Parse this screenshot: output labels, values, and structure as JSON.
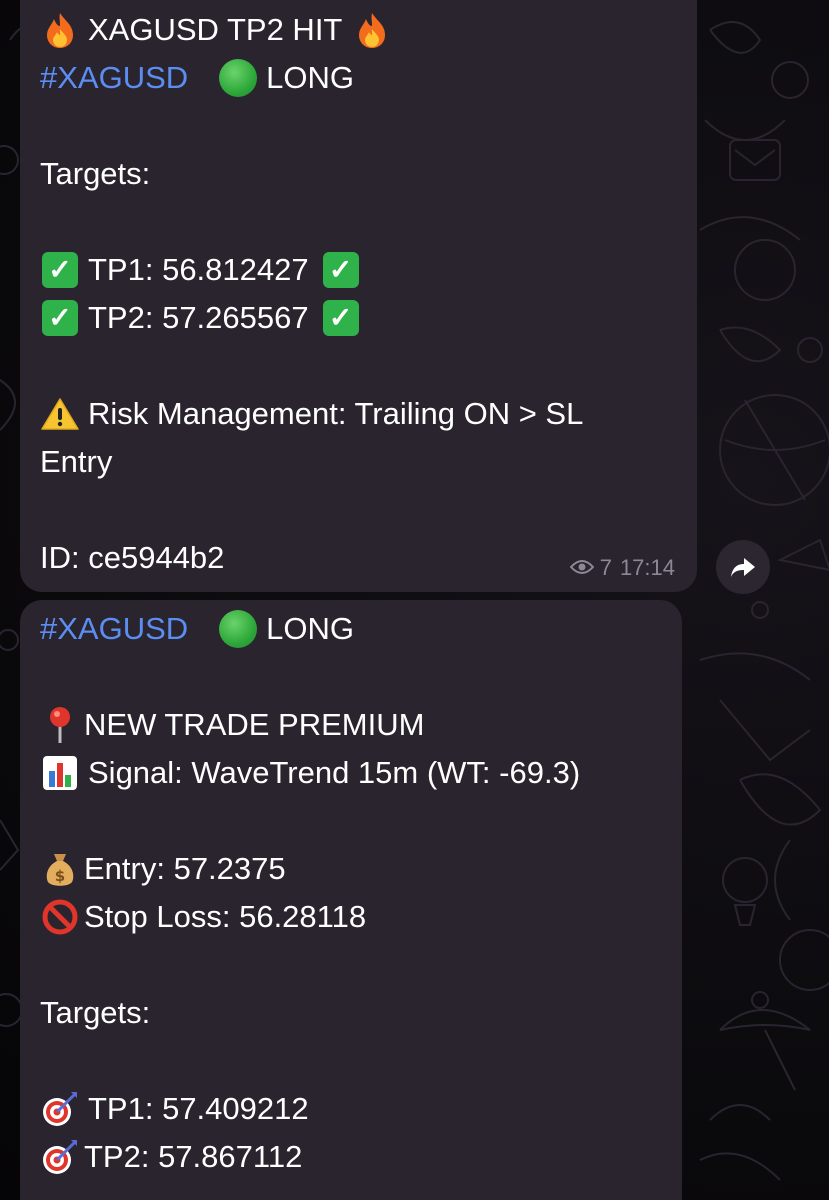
{
  "message1": {
    "title": "XAGUSD TP2 HIT",
    "hashtag": "#XAGUSD",
    "direction": "LONG",
    "targets_label": "Targets:",
    "tp1": "TP1: 56.812427",
    "tp2": "TP2: 57.265567",
    "risk_line1": "Risk Management: Trailing ON > SL",
    "risk_line2": "Entry",
    "id": "ID: ce5944b2",
    "views": "7",
    "time": "17:14"
  },
  "message2": {
    "hashtag": "#XAGUSD",
    "direction": "LONG",
    "new_trade": "NEW TRADE PREMIUM",
    "signal": "Signal: WaveTrend 15m (WT: -69.3)",
    "entry": "Entry: 57.2375",
    "stop_loss": "Stop Loss: 56.28118",
    "targets_label": "Targets:",
    "tp1": "TP1: 57.409212",
    "tp2": "TP2: 57.867112"
  },
  "icons": {
    "fire": "fire-icon",
    "green_circle": "green-circle-icon",
    "check": "check-mark-button-icon",
    "warning": "warning-icon",
    "pin": "round-pushpin-icon",
    "bar_chart": "bar-chart-icon",
    "money_bag": "money-bag-icon",
    "prohibited": "prohibited-icon",
    "target": "direct-hit-icon",
    "eye": "eye-icon",
    "share": "share-arrow-icon"
  },
  "colors": {
    "bubble_bg": "#29242e",
    "hashtag": "#5c8ef2",
    "text": "#ffffff",
    "meta": "#8e8794",
    "check_green": "#2fb24a"
  }
}
